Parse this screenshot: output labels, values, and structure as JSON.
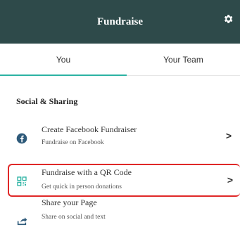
{
  "header": {
    "title": "Fundraise",
    "settings_icon": "gear-icon"
  },
  "tabs": [
    {
      "label": "You",
      "selected": true
    },
    {
      "label": "Your Team",
      "selected": false
    }
  ],
  "section": {
    "title": "Social & Sharing"
  },
  "items": [
    {
      "title": "Create Facebook Fundraiser",
      "subtitle": "Fundraise on Facebook",
      "icon": "facebook-icon"
    },
    {
      "title": "Fundraise with a QR Code",
      "subtitle": "Get quick in person donations",
      "icon": "qr-code-icon",
      "highlighted": true
    },
    {
      "title": "Share your Page",
      "subtitle": "Share on social and text",
      "icon": "share-icon"
    }
  ],
  "colors": {
    "header_bg": "#2e4a4a",
    "accent": "#2cb3a3",
    "highlight_border": "#e02828"
  }
}
